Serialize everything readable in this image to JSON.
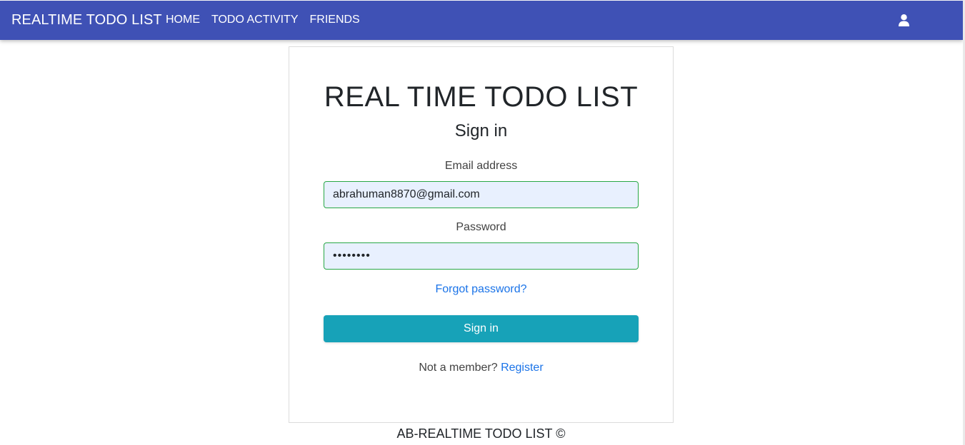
{
  "navbar": {
    "brand": "REALTIME TODO LIST",
    "links": [
      {
        "label": "HOME"
      },
      {
        "label": "TODO ACTIVITY"
      },
      {
        "label": "FRIENDS"
      }
    ],
    "user_icon": "user-icon",
    "background_color": "#3f51b5"
  },
  "login": {
    "title": "REAL TIME TODO LIST",
    "subtitle": "Sign in",
    "email_label": "Email address",
    "email_value": "abrahuman8870@gmail.com",
    "password_label": "Password",
    "password_value": "••••••••",
    "forgot_password": "Forgot password?",
    "signin_button": "Sign in",
    "not_member_text": "Not a member?",
    "register_link": "Register",
    "button_color": "#17a2b8",
    "link_color": "#1a73e8"
  },
  "footer": {
    "text": "AB-REALTIME TODO LIST ©"
  }
}
